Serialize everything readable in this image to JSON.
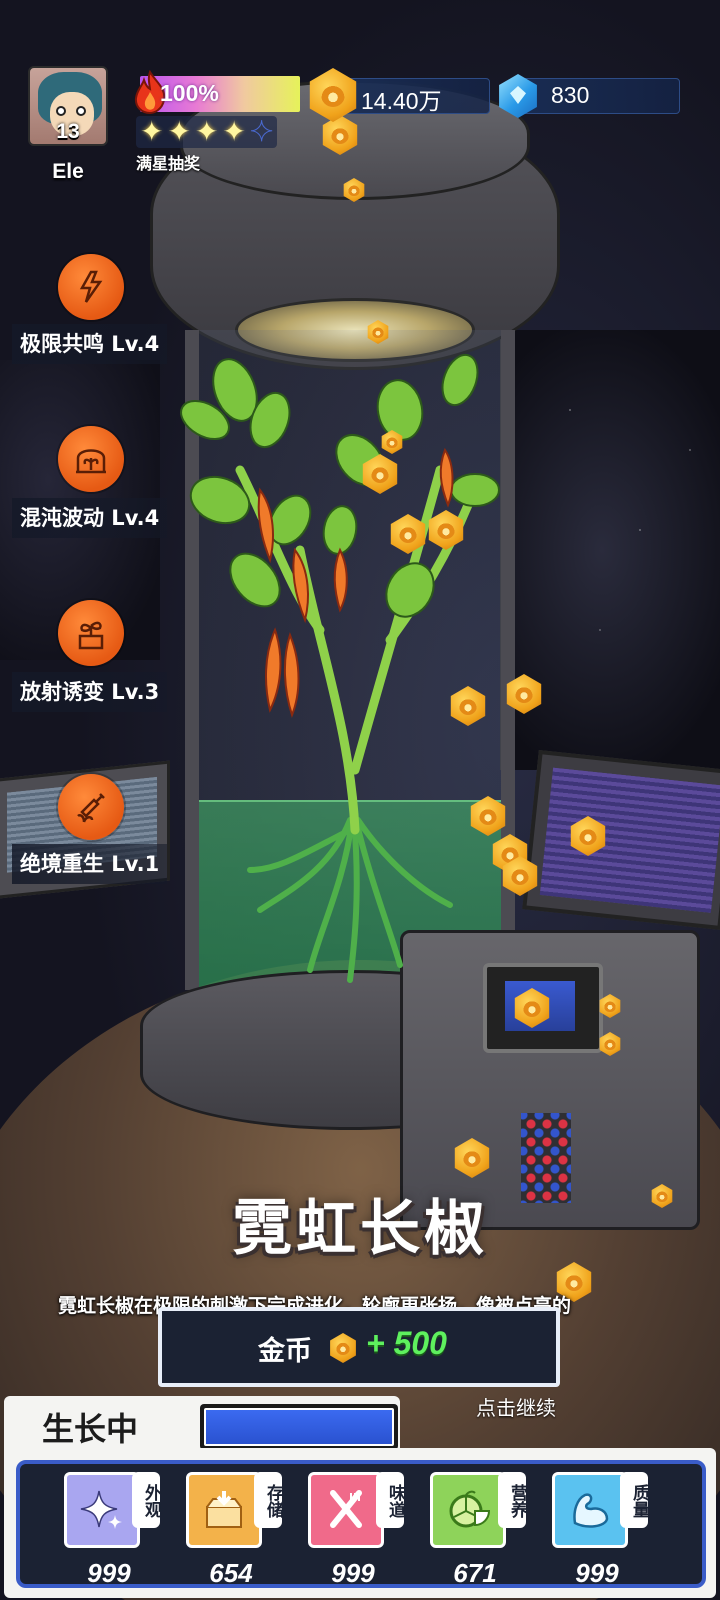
{
  "player": {
    "level": "13",
    "name": "Ele"
  },
  "star_progress": {
    "percent_label": "100%",
    "fill_fraction": 1.0,
    "stars_filled": 4,
    "stars_total": 5,
    "label": "满星抽奖"
  },
  "currency": {
    "gold": "14.40万",
    "gems": "830"
  },
  "skills": [
    {
      "label": "极限共鸣 Lv.4",
      "icon": "lightning-plant-icon"
    },
    {
      "label": "混沌波动 Lv.4",
      "icon": "dome-plant-icon"
    },
    {
      "label": "放射诱变 Lv.3",
      "icon": "sprout-box-icon"
    },
    {
      "label": "绝境重生 Lv.1",
      "icon": "syringe-plant-icon"
    }
  ],
  "result": {
    "plant_name": "霓虹长椒",
    "description": "霓虹长椒在极限的刺激下完成进化，轮廓更张扬，像被点亮的",
    "reward_label": "金币",
    "reward_amount": "+ 500",
    "continue": "点击继续"
  },
  "growth": {
    "status": "生长中",
    "fill_fraction": 1.0
  },
  "stats": [
    {
      "tag": "外观",
      "value": "999",
      "color": "#a9a6f0",
      "icon": "sparkle-icon"
    },
    {
      "tag": "存储",
      "value": "654",
      "color": "#f3b24a",
      "icon": "box-icon"
    },
    {
      "tag": "味道",
      "value": "999",
      "color": "#f06a8a",
      "icon": "fork-knife-icon"
    },
    {
      "tag": "营养",
      "value": "671",
      "color": "#8ed35a",
      "icon": "lime-icon"
    },
    {
      "tag": "质量",
      "value": "999",
      "color": "#5ac2f0",
      "icon": "muscle-icon"
    }
  ]
}
